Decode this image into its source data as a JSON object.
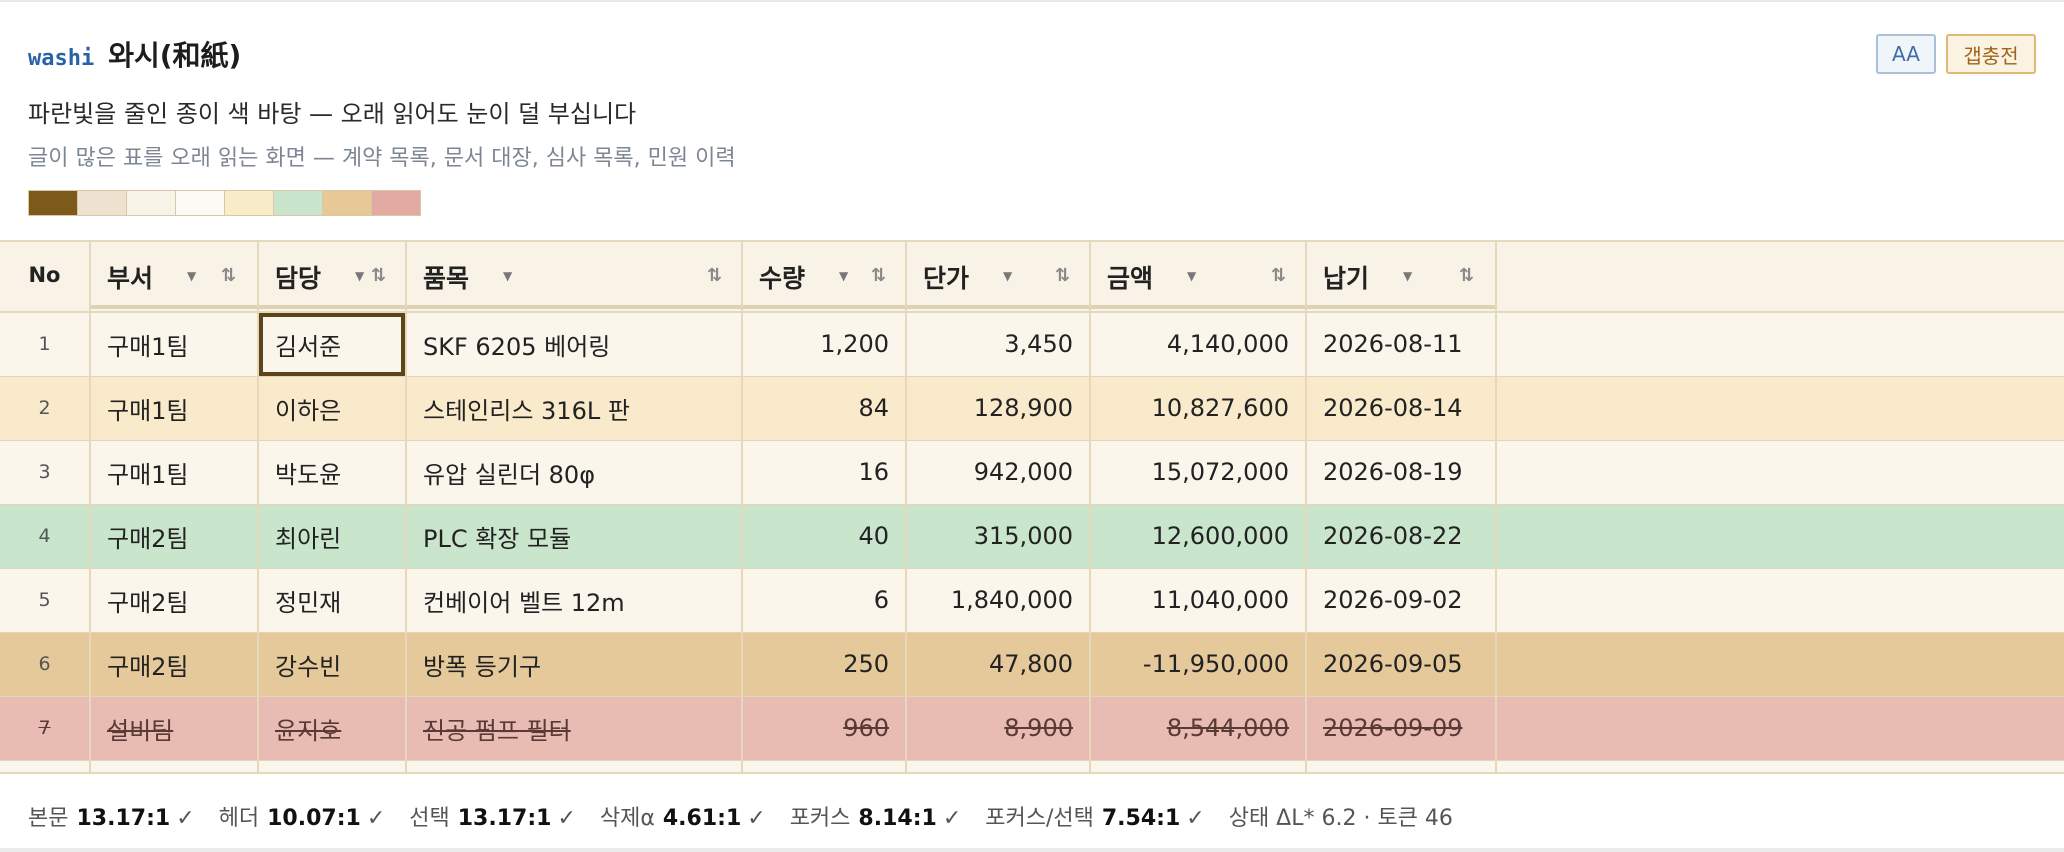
{
  "brand": "washi",
  "title": "와시(和紙)",
  "description": "파란빛을 줄인 종이 색 바탕 — 오래 읽어도 눈이 덜 부십니다",
  "subtitle": "글이 많은 표를 오래 읽는 화면 — 계약 목록, 문서 대장, 심사 목록, 민원 이력",
  "buttons": {
    "aa": "AA",
    "preset": "갭충전"
  },
  "palette": [
    "#7d5a1a",
    "#ece2cf",
    "#f7f3e6",
    "#fcfaf4",
    "#f9ecc9",
    "#c9e5cc",
    "#e6c996",
    "#e3aaa4"
  ],
  "table": {
    "columns": [
      {
        "key": "no",
        "label": "No"
      },
      {
        "key": "dept",
        "label": "부서"
      },
      {
        "key": "owner",
        "label": "담당"
      },
      {
        "key": "item",
        "label": "품목"
      },
      {
        "key": "qty",
        "label": "수량"
      },
      {
        "key": "price",
        "label": "단가"
      },
      {
        "key": "amount",
        "label": "금액"
      },
      {
        "key": "due",
        "label": "납기"
      }
    ],
    "rows": [
      {
        "no": "1",
        "dept": "구매1팀",
        "owner": "김서준",
        "item": "SKF 6205 베어링",
        "qty": "1,200",
        "price": "3,450",
        "amount": "4,140,000",
        "due": "2026-08-11",
        "state": "plain"
      },
      {
        "no": "2",
        "dept": "구매1팀",
        "owner": "이하은",
        "item": "스테인리스 316L 판",
        "qty": "84",
        "price": "128,900",
        "amount": "10,827,600",
        "due": "2026-08-14",
        "state": "amber"
      },
      {
        "no": "3",
        "dept": "구매1팀",
        "owner": "박도윤",
        "item": "유압 실린더 80φ",
        "qty": "16",
        "price": "942,000",
        "amount": "15,072,000",
        "due": "2026-08-19",
        "state": "plain"
      },
      {
        "no": "4",
        "dept": "구매2팀",
        "owner": "최아린",
        "item": "PLC 확장 모듈",
        "qty": "40",
        "price": "315,000",
        "amount": "12,600,000",
        "due": "2026-08-22",
        "state": "green"
      },
      {
        "no": "5",
        "dept": "구매2팀",
        "owner": "정민재",
        "item": "컨베이어 벨트 12m",
        "qty": "6",
        "price": "1,840,000",
        "amount": "11,040,000",
        "due": "2026-09-02",
        "state": "plain"
      },
      {
        "no": "6",
        "dept": "구매2팀",
        "owner": "강수빈",
        "item": "방폭 등기구",
        "qty": "250",
        "price": "47,800",
        "amount": "-11,950,000",
        "due": "2026-09-05",
        "state": "tan"
      },
      {
        "no": "7",
        "dept": "설비팀",
        "owner": "윤지호",
        "item": "진공 펌프 필터",
        "qty": "960",
        "price": "8,900",
        "amount": "8,544,000",
        "due": "2026-09-09",
        "state": "deleted"
      },
      {
        "no": "",
        "dept": "",
        "owner": "",
        "item": "",
        "qty": "",
        "price": "",
        "amount": "",
        "due": "",
        "state": "plain"
      }
    ],
    "focused_cell": {
      "row": 0,
      "col": "owner"
    }
  },
  "footer": {
    "stats": [
      {
        "label": "본문",
        "value": "13.17:1",
        "check": "✓"
      },
      {
        "label": "헤더",
        "value": "10.07:1",
        "check": "✓"
      },
      {
        "label": "선택",
        "value": "13.17:1",
        "check": "✓"
      },
      {
        "label": "삭제α",
        "value": "4.61:1",
        "check": "✓"
      },
      {
        "label": "포커스",
        "value": "8.14:1",
        "check": "✓"
      },
      {
        "label": "포커스/선택",
        "value": "7.54:1",
        "check": "✓"
      }
    ],
    "state_note": "상태 ΔL* 6.2 · 토큰 46"
  }
}
